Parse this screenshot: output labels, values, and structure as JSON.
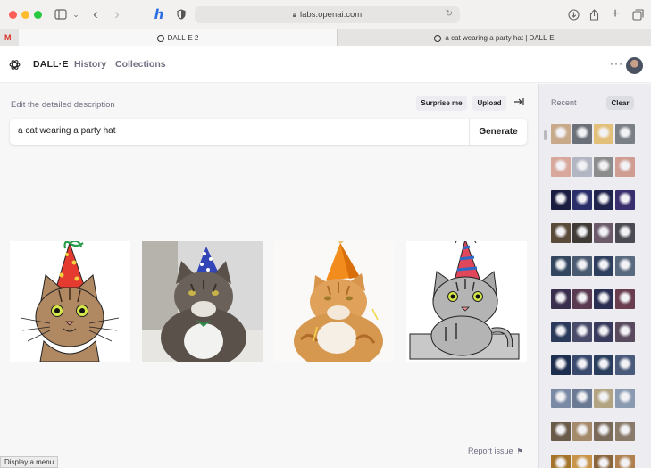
{
  "browser": {
    "url": "labs.openai.com",
    "tabs": [
      {
        "label": "DALL·E 2",
        "active": true
      },
      {
        "label": "a cat wearing a party hat | DALL·E",
        "active": false
      }
    ],
    "gmail_icon": "M"
  },
  "app": {
    "brand": "DALL·E",
    "nav": [
      "History",
      "Collections"
    ],
    "more_icon": "···"
  },
  "editor": {
    "label": "Edit the detailed description",
    "surprise_label": "Surprise me",
    "upload_label": "Upload",
    "prompt_value": "a cat wearing a party hat",
    "generate_label": "Generate"
  },
  "results_count": 4,
  "footer": {
    "report_label": "Report issue",
    "status_text": "Display a menu"
  },
  "sidebar": {
    "recent_label": "Recent",
    "clear_label": "Clear",
    "rows": [
      [
        "#c8a98a",
        "#6b6f77",
        "#e2c07a",
        "#7b7f86"
      ],
      [
        "#d8a89c",
        "#b2b6c2",
        "#8c8c8c",
        "#cf9d92"
      ],
      [
        "#1a1d3f",
        "#2a2f6a",
        "#20244c",
        "#3a2e6e"
      ],
      [
        "#5a4a3a",
        "#3f3a36",
        "#6a5a6a",
        "#4a4a52"
      ],
      [
        "#32465e",
        "#4a5a70",
        "#2e3e5e",
        "#5a6a7e"
      ],
      [
        "#3a2e4e",
        "#5a3a50",
        "#2a2e52",
        "#6a3e4e"
      ],
      [
        "#2a3a5a",
        "#4a4a6a",
        "#3a3a5e",
        "#5a4a5e"
      ],
      [
        "#1e2e4e",
        "#3a4a6e",
        "#2a3e5e",
        "#4a5a7a"
      ],
      [
        "#7a8aa4",
        "#6a7a94",
        "#b2a482",
        "#8a9ab0"
      ],
      [
        "#6a5a4a",
        "#a48a6a",
        "#7a6a5a",
        "#8a7a6a"
      ],
      [
        "#a4742a",
        "#c8944a",
        "#8a643a",
        "#b08050"
      ]
    ]
  }
}
